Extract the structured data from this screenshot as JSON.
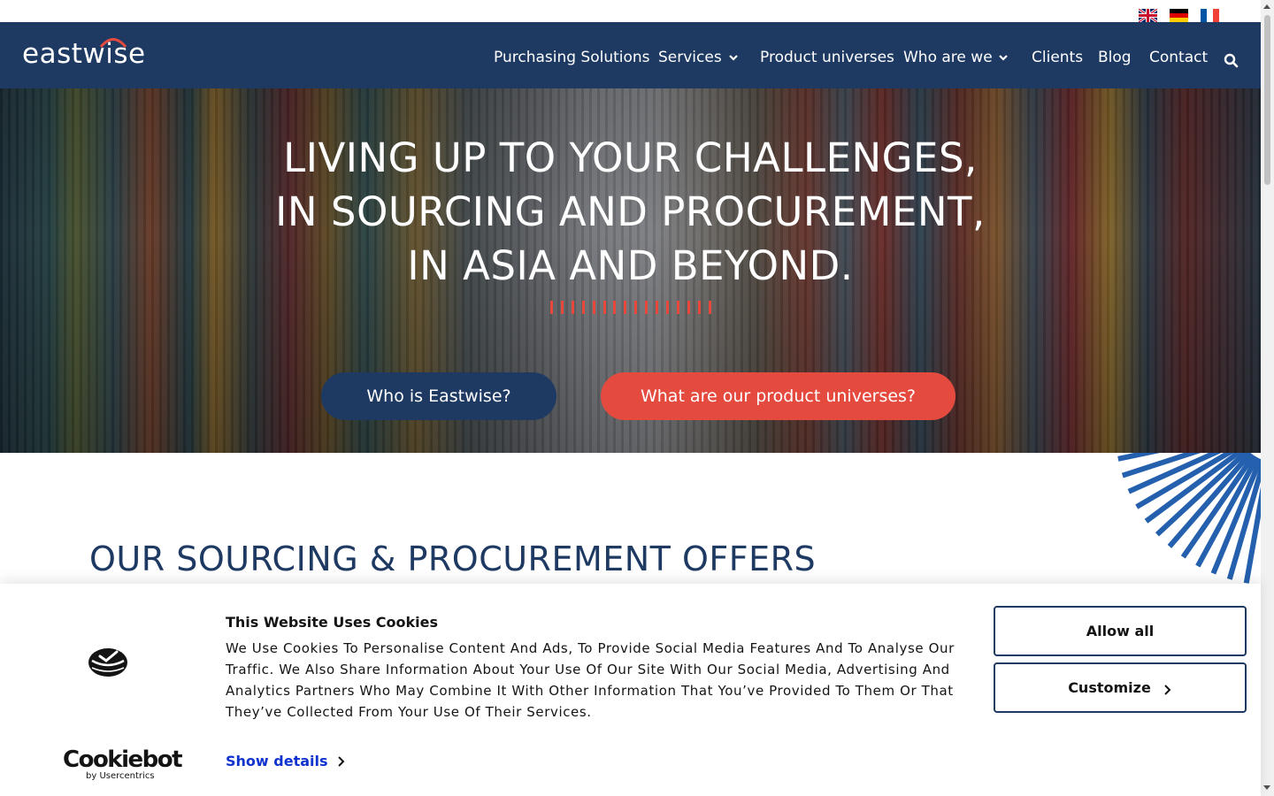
{
  "header": {
    "logo_text": "eastwise",
    "languages": [
      "English",
      "Deutsch",
      "Français"
    ],
    "nav": [
      {
        "label": "Purchasing Solutions",
        "has_dropdown": false
      },
      {
        "label": "Services",
        "has_dropdown": true
      },
      {
        "label": "Product universes",
        "has_dropdown": false
      },
      {
        "label": "Who are we",
        "has_dropdown": true
      },
      {
        "label": "Clients",
        "has_dropdown": false
      },
      {
        "label": "Blog",
        "has_dropdown": false
      },
      {
        "label": "Contact",
        "has_dropdown": false
      }
    ],
    "search_icon": "search-icon"
  },
  "hero": {
    "title_lines": [
      "LIVING UP TO YOUR CHALLENGES,",
      "IN SOURCING AND PROCUREMENT,",
      "IN ASIA AND BEYOND."
    ],
    "button_who": "Who is Eastwise?",
    "button_universes": "What are our product universes?"
  },
  "section": {
    "title": "OUR SOURCING & PROCUREMENT OFFERS"
  },
  "cookie_banner": {
    "title": "This Website Uses Cookies",
    "text": "We Use Cookies To Personalise Content And Ads, To Provide Social Media Features And To Analyse Our Traffic. We Also Share Information About Your Use Of Our Site With Our Social Media, Advertising And Analytics Partners Who May Combine It With Other Information That You’ve Provided To Them Or That They’ve Collected From Your Use Of Their Services.",
    "show_details": "Show details",
    "allow_all": "Allow all",
    "customize": "Customize",
    "brand_main": "Cookiebot",
    "brand_sub": "by Usercentrics"
  },
  "colors": {
    "navy": "#1e3a63",
    "coral": "#e54a3f",
    "link_blue": "#1032cf",
    "ray_blue": "#2460ad"
  }
}
